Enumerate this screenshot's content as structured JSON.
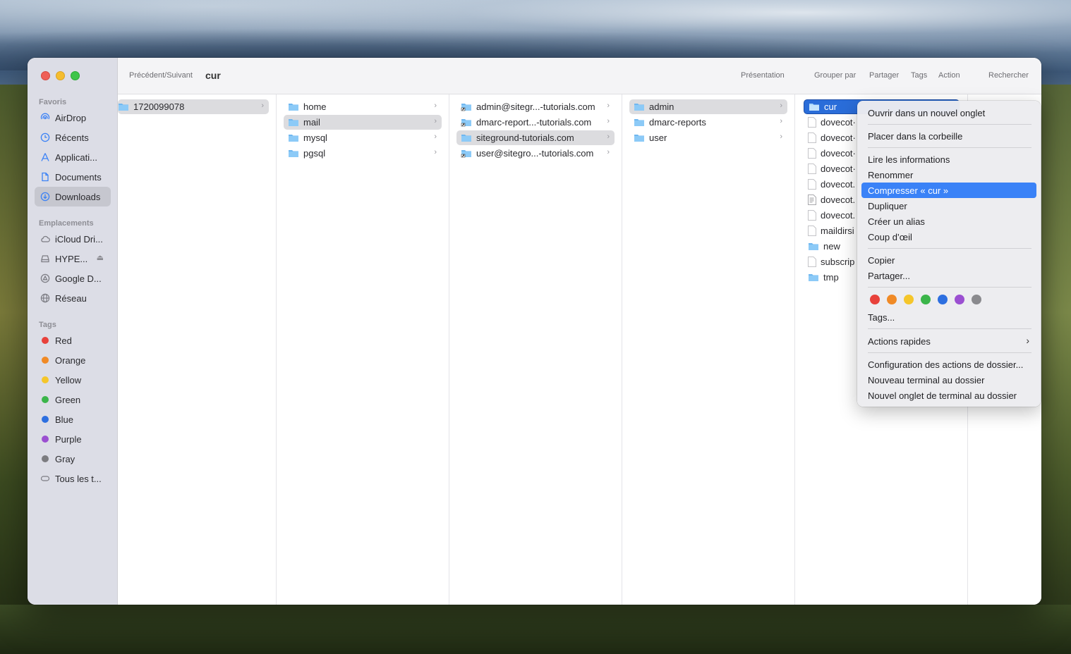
{
  "toolbar": {
    "nav_label": "Précédent/Suivant",
    "title": "cur",
    "presentation": "Présentation",
    "group_by": "Grouper par",
    "share": "Partager",
    "tags": "Tags",
    "action": "Action",
    "search": "Rechercher"
  },
  "sidebar": {
    "favorites_heading": "Favoris",
    "favorites": [
      {
        "label": "AirDrop",
        "icon": "airdrop-icon"
      },
      {
        "label": "Récents",
        "icon": "clock-icon"
      },
      {
        "label": "Applicati...",
        "icon": "applications-icon"
      },
      {
        "label": "Documents",
        "icon": "document-icon"
      },
      {
        "label": "Downloads",
        "icon": "download-icon"
      }
    ],
    "locations_heading": "Emplacements",
    "locations": [
      {
        "label": "iCloud Dri...",
        "icon": "cloud-icon"
      },
      {
        "label": "HYPE...",
        "icon": "disk-icon"
      },
      {
        "label": "Google D...",
        "icon": "google-drive-icon"
      },
      {
        "label": "Réseau",
        "icon": "network-icon"
      }
    ],
    "tags_heading": "Tags",
    "tags": [
      {
        "label": "Red",
        "color": "#e8413b"
      },
      {
        "label": "Orange",
        "color": "#f08a26"
      },
      {
        "label": "Yellow",
        "color": "#f5c62b"
      },
      {
        "label": "Green",
        "color": "#3bb54a"
      },
      {
        "label": "Blue",
        "color": "#2d6fe0"
      },
      {
        "label": "Purple",
        "color": "#9b4fd1"
      },
      {
        "label": "Gray",
        "color": "#7c7c80"
      },
      {
        "label": "Tous les t...",
        "color": ""
      }
    ]
  },
  "columns": {
    "col1": [
      "1720099078"
    ],
    "col2": [
      "home",
      "mail",
      "mysql",
      "pgsql"
    ],
    "col3": [
      "admin@sitegr...-tutorials.com",
      "dmarc-report...-tutorials.com",
      "siteground-tutorials.com",
      "user@sitegro...-tutorials.com"
    ],
    "col4": [
      "admin",
      "dmarc-reports",
      "user"
    ],
    "col5": [
      "cur",
      "dovecot·",
      "dovecot·",
      "dovecot·",
      "dovecot·",
      "dovecot.",
      "dovecot.",
      "dovecot.",
      "maildirsi",
      "new",
      "subscrip",
      "tmp"
    ]
  },
  "context_menu": {
    "open_new_tab": "Ouvrir dans un nouvel onglet",
    "move_to_trash": "Placer dans la corbeille",
    "get_info": "Lire les informations",
    "rename": "Renommer",
    "compress": "Compresser « cur »",
    "duplicate": "Dupliquer",
    "make_alias": "Créer un alias",
    "quick_look": "Coup d’œil",
    "copy": "Copier",
    "share": "Partager...",
    "tags": "Tags...",
    "quick_actions": "Actions rapides",
    "folder_actions": "Configuration des actions de dossier...",
    "new_terminal": "Nouveau terminal au dossier",
    "new_terminal_tab": "Nouvel onglet de terminal au dossier",
    "tag_colors": [
      "#e8413b",
      "#f08a26",
      "#f5c62b",
      "#3bb54a",
      "#2d6fe0",
      "#9b4fd1",
      "#8a8a8e"
    ]
  }
}
